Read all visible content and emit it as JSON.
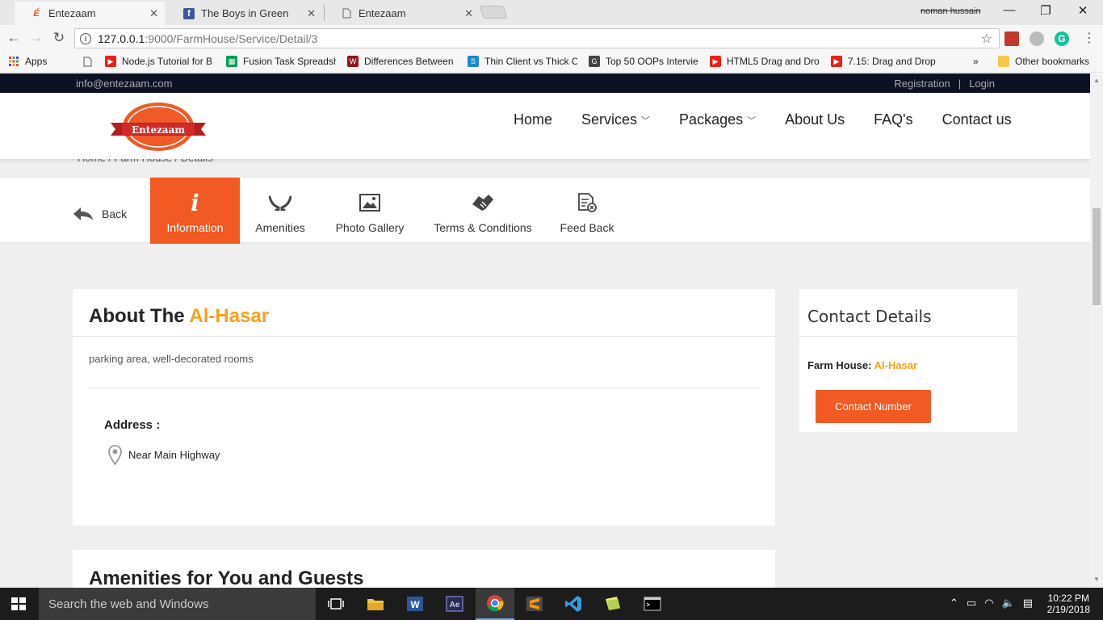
{
  "browser": {
    "tabs": [
      {
        "title": "Entezaam",
        "icon": "entezaam-icon"
      },
      {
        "title": "The Boys in Green",
        "icon": "facebook-icon"
      },
      {
        "title": "Entezaam",
        "icon": "page-icon"
      }
    ],
    "user": "noman hussain",
    "url_host": "127.0.0.1",
    "url_path": ":9000/FarmHouse/Service/Detail/3",
    "bookmarks": [
      {
        "label": "Apps",
        "icon": "apps-grid-icon"
      },
      {
        "label": "",
        "icon": "page-icon"
      },
      {
        "label": "Node.js Tutorial for B",
        "icon": "youtube-icon"
      },
      {
        "label": "Fusion Task Spreadsh",
        "icon": "sheets-icon"
      },
      {
        "label": "Differences Between",
        "icon": "w-icon"
      },
      {
        "label": "Thin Client vs Thick C",
        "icon": "s-icon"
      },
      {
        "label": "Top 50 OOPs Intervie",
        "icon": "g-icon"
      },
      {
        "label": "HTML5 Drag and Dro",
        "icon": "youtube-icon"
      },
      {
        "label": "7.15: Drag and Drop",
        "icon": "youtube-icon"
      }
    ],
    "more": "»",
    "other_bookmarks": "Other bookmarks"
  },
  "site": {
    "email": "info@entezaam.com",
    "registration": "Registration",
    "separator": "|",
    "login": "Login",
    "logo_text": "Entezaam",
    "nav": [
      {
        "label": "Home",
        "dropdown": false
      },
      {
        "label": "Services",
        "dropdown": true
      },
      {
        "label": "Packages",
        "dropdown": true
      },
      {
        "label": "About Us",
        "dropdown": false
      },
      {
        "label": "FAQ's",
        "dropdown": false
      },
      {
        "label": "Contact us",
        "dropdown": false
      }
    ],
    "breadcrumb": "Home  /  Farm House  /  Details"
  },
  "tabs": {
    "back": "Back",
    "items": [
      {
        "label": "Information",
        "icon": "info-icon",
        "active": true
      },
      {
        "label": "Amenities",
        "icon": "hands-icon",
        "active": false
      },
      {
        "label": "Photo Gallery",
        "icon": "image-icon",
        "active": false
      },
      {
        "label": "Terms & Conditions",
        "icon": "handshake-icon",
        "active": false
      },
      {
        "label": "Feed Back",
        "icon": "feedback-icon",
        "active": false
      }
    ]
  },
  "about": {
    "title_prefix": "About The",
    "title_name": "Al-Hasar",
    "description": "parking area, well-decorated rooms",
    "address_label": "Address :",
    "address": "Near Main Highway"
  },
  "contact": {
    "title": "Contact Details",
    "farm_label": "Farm House:",
    "farm_name": "Al-Hasar",
    "button": "Contact Number"
  },
  "amenities": {
    "title": "Amenities for You and Guests"
  },
  "colors": {
    "accent_orange": "#f25a24",
    "accent_gold": "#f4a11d",
    "topbar": "#0d1124"
  },
  "taskbar": {
    "search": "Search the web and Windows",
    "time": "10:22 PM",
    "date": "2/19/2018"
  }
}
